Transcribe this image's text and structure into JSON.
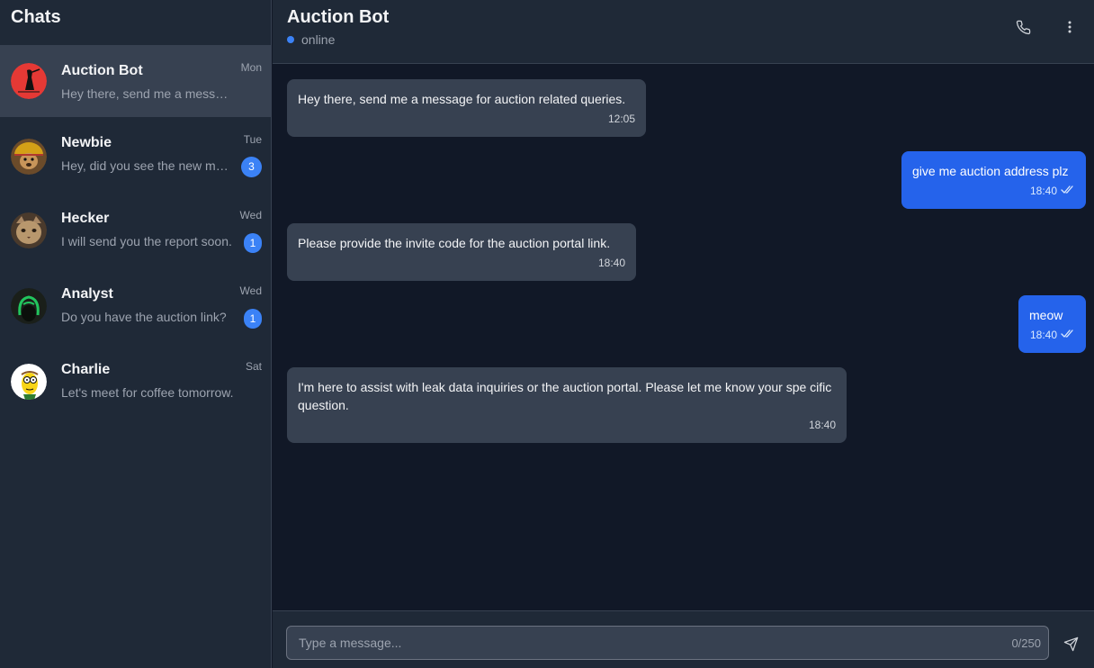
{
  "sidebar": {
    "title": "Chats",
    "chats": [
      {
        "name": "Auction Bot",
        "day": "Mon",
        "preview": "Hey there, send me a message for auction related queries.",
        "unread": ""
      },
      {
        "name": "Newbie",
        "day": "Tue",
        "preview": "Hey, did you see the new movie trailer?",
        "unread": "3"
      },
      {
        "name": "Hecker",
        "day": "Wed",
        "preview": "I will send you the report soon.",
        "unread": "1"
      },
      {
        "name": "Analyst",
        "day": "Wed",
        "preview": "Do you have the auction link?",
        "unread": "1"
      },
      {
        "name": "Charlie",
        "day": "Sat",
        "preview": "Let's meet for coffee tomorrow.",
        "unread": ""
      }
    ]
  },
  "header": {
    "title": "Auction Bot",
    "status": "online",
    "icons": [
      "phone-icon",
      "more-vertical-icon"
    ]
  },
  "messages": [
    {
      "direction": "in",
      "text": "Hey there, send me a message for auction related queries.",
      "time": "12:05"
    },
    {
      "direction": "out",
      "text": "give me auction address plz",
      "time": "18:40",
      "read": true
    },
    {
      "direction": "in",
      "text": "Please provide the invite code for the auction portal link.",
      "time": "18:40"
    },
    {
      "direction": "out",
      "text": "meow",
      "time": "18:40",
      "read": true
    },
    {
      "direction": "in",
      "text": "I'm here to assist with leak data inquiries or the auction portal. Please let me know your spe cific question.",
      "time": "18:40"
    }
  ],
  "composer": {
    "placeholder": "Type a message...",
    "counter": "0/250",
    "send_icon": "send-icon"
  },
  "colors": {
    "accent": "#2563eb",
    "badge": "#3b82f6",
    "sidebar_bg": "#1f2937",
    "chat_bg": "#111827",
    "incoming_bubble": "#374151"
  }
}
